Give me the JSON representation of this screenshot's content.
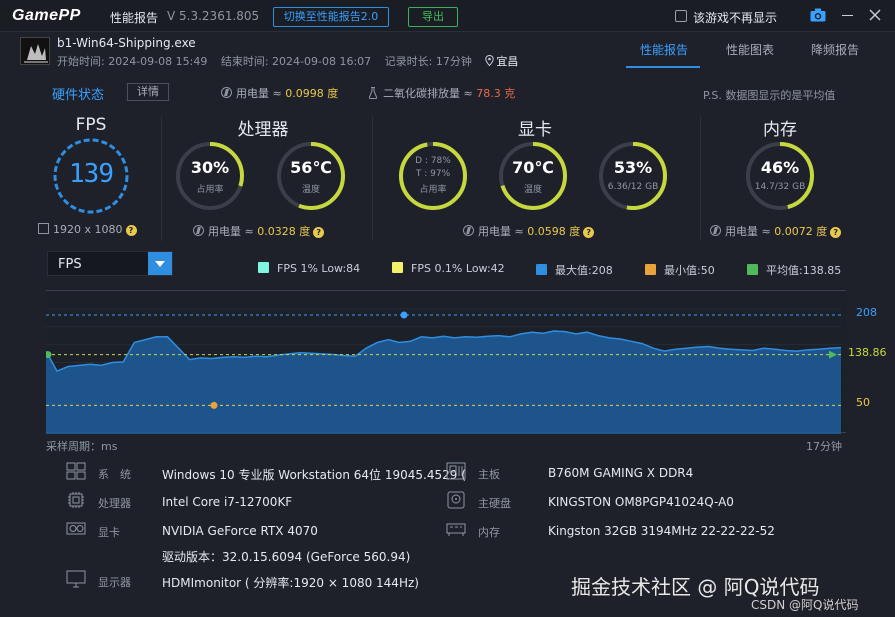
{
  "app": {
    "logo": "GamePP",
    "title": "性能报告",
    "version": "V 5.3.2361.805",
    "switch_button": "切换至性能报告2.0",
    "export_button": "导出",
    "dont_show_label": "该游戏不再显示"
  },
  "game": {
    "name": "b1-Win64-Shipping.exe",
    "start": "开始时间: 2024-09-08 15:49",
    "end": "结束时间: 2024-09-08 16:07",
    "duration": "记录时长: 17分钟",
    "location": "宜昌"
  },
  "tabs": [
    "性能报告",
    "性能图表",
    "降频报告"
  ],
  "hw_status": {
    "title": "硬件状态",
    "detail_button": "详情",
    "power_label": "用电量 ≈ ",
    "power_value": "0.0998 度",
    "co2_label": "二氧化碳排放量 ≈ ",
    "co2_value": "78.3 克",
    "note": "P.S. 数据图显示的是平均值"
  },
  "sections": {
    "fps": {
      "title": "FPS",
      "value": "139",
      "resolution": "1920 x 1080"
    },
    "cpu": {
      "title": "处理器",
      "usage_value": "30%",
      "usage_label": "占用率",
      "usage_fraction": 0.3,
      "temp_value": "56℃",
      "temp_label": "温度",
      "temp_fraction": 0.56,
      "power_label": "用电量 ≈ ",
      "power_value": "0.0328 度"
    },
    "gpu": {
      "title": "显卡",
      "d_text": "D : 78%",
      "t_text": "T : 97%",
      "usage_label": "占用率",
      "usage_fraction": 0.97,
      "temp_value": "70℃",
      "temp_label": "温度",
      "temp_fraction": 0.7,
      "vram_value": "53%",
      "vram_detail": "6.36/12 GB",
      "vram_fraction": 0.53,
      "power_label": "用电量 ≈ ",
      "power_value": "0.0598 度"
    },
    "mem": {
      "title": "内存",
      "usage_value": "46%",
      "usage_detail": "14.7/32 GB",
      "usage_fraction": 0.46,
      "power_label": "用电量 ≈ ",
      "power_value": "0.0072 度"
    }
  },
  "chart_controls": {
    "select_value": "FPS",
    "legend": [
      {
        "label": "FPS 1% Low:84",
        "color": "#7ff5e0"
      },
      {
        "label": "FPS 0.1% Low:42",
        "color": "#f5f06a"
      },
      {
        "label": "最大值:208",
        "color": "#2f8ee0"
      },
      {
        "label": "最小值:50",
        "color": "#e8a33b"
      },
      {
        "label": "平均值:138.85",
        "color": "#4fb95c"
      }
    ],
    "x_left_label": "采样周期：ms",
    "x_right_label": "17分钟"
  },
  "chart_data": {
    "type": "area",
    "title": "",
    "xlabel": "采样周期：ms",
    "ylabel": "",
    "ylim": [
      0,
      250
    ],
    "x_end_label": "17分钟",
    "ref_lines": [
      {
        "name": "最大值",
        "value": 208,
        "label": "208"
      },
      {
        "name": "平均值",
        "value": 138.85,
        "label": "138.86"
      },
      {
        "name": "最小值",
        "value": 50,
        "label": "50"
      }
    ],
    "series": [
      {
        "values": [
          145,
          110,
          118,
          120,
          122,
          120,
          125,
          126,
          160,
          165,
          170,
          170,
          150,
          130,
          133,
          132,
          134,
          135,
          134,
          136,
          135,
          138,
          140,
          142,
          141,
          140,
          139,
          137,
          136,
          150,
          160,
          165,
          160,
          162,
          170,
          168,
          171,
          168,
          170,
          169,
          171,
          172,
          170,
          175,
          178,
          176,
          180,
          179,
          175,
          178,
          172,
          168,
          166,
          162,
          158,
          150,
          145,
          148,
          150,
          152,
          153,
          150,
          148,
          147,
          146,
          150,
          148,
          146,
          145,
          147,
          148,
          150,
          151
        ]
      }
    ]
  },
  "system": {
    "os_key": "系　统",
    "os_val": "Windows 10 专业版 Workstation 64位 19045.4529 (",
    "cpu_key": "处理器",
    "cpu_val": "Intel Core i7-12700KF",
    "gpu_key": "显卡",
    "gpu_val": "NVIDIA GeForce RTX 4070",
    "driver_val": "驱动版本：32.0.15.6094 (GeForce 560.94)",
    "monitor_key": "显示器",
    "monitor_val": "HDMImonitor ( 分辨率:1920 × 1080 144Hz)",
    "board_key": "主板",
    "board_val": "B760M GAMING X DDR4",
    "disk_key": "主硬盘",
    "disk_val": "KINGSTON OM8PGP41024Q-A0",
    "ram_key": "内存",
    "ram_val": "Kingston 32GB 3194MHz 22-22-22-52"
  },
  "watermark": {
    "main": "掘金技术社区 @ 阿Q说代码",
    "sub": "CSDN @阿Q说代码"
  },
  "colors": {
    "accent": "#2f8ee0",
    "gauge_track": "#3a3f49",
    "gauge_fill": "#c7d83f",
    "fps_ring": "#2f8ee0"
  }
}
